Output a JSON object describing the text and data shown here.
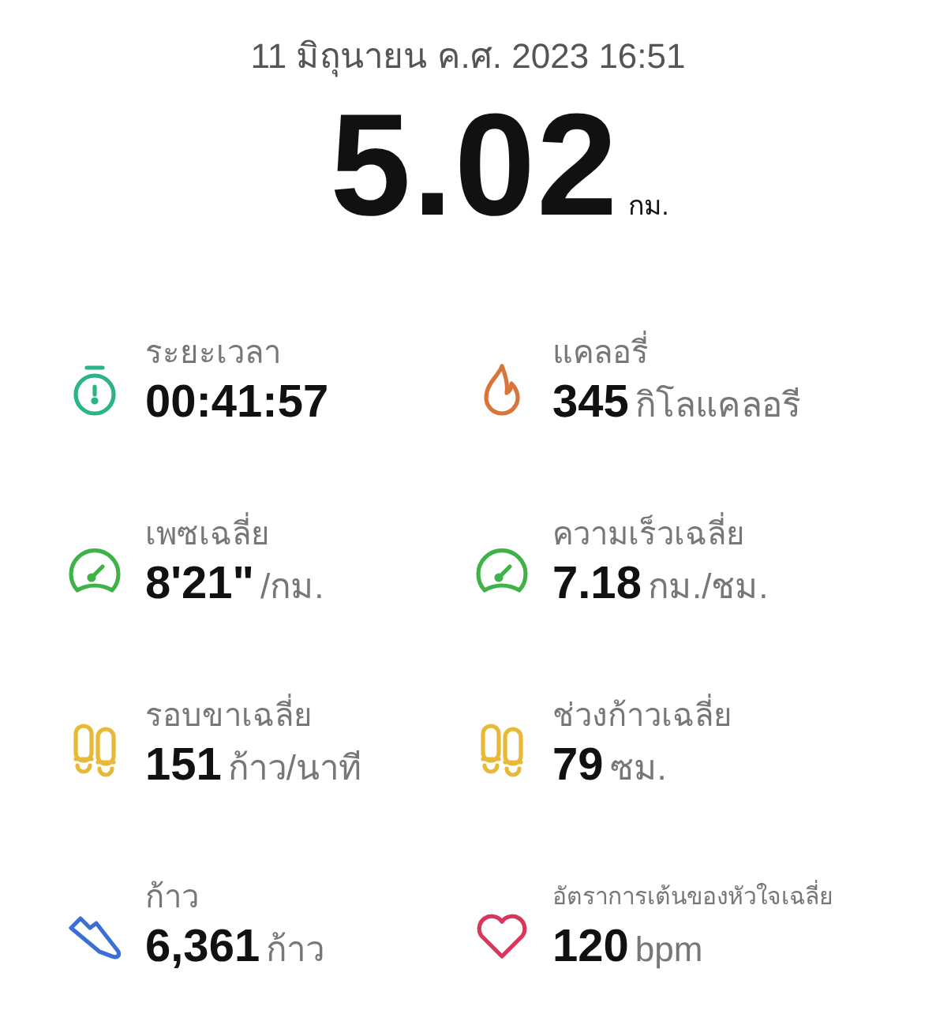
{
  "date": "11 มิถุนายน ค.ศ. 2023 16:51",
  "distance": {
    "value": "5.02",
    "unit": "กม."
  },
  "stats": [
    {
      "kind": "stopwatch",
      "color": "#2bb38a",
      "label": "ระยะเวลา",
      "value": "00:41:57"
    },
    {
      "kind": "flame",
      "color": "#d9743a",
      "label": "แคลอรี่",
      "value": "345",
      "unit": "กิโลแคลอรี"
    },
    {
      "kind": "gauge",
      "color": "#3fb24a",
      "label": "เพซเฉลี่ย",
      "value": "8'21\"",
      "unit": "/กม."
    },
    {
      "kind": "gauge",
      "color": "#3fb24a",
      "label": "ความเร็วเฉลี่ย",
      "value": "7.18",
      "unit": "กม./ชม."
    },
    {
      "kind": "footprints",
      "color": "#e8b936",
      "label": "รอบขาเฉลี่ย",
      "value": "151",
      "unit": "ก้าว/นาที"
    },
    {
      "kind": "footprints",
      "color": "#e8b936",
      "label": "ช่วงก้าวเฉลี่ย",
      "value": "79",
      "unit": "ซม."
    },
    {
      "kind": "shoe",
      "color": "#3b6fd6",
      "label": "ก้าว",
      "value": "6,361",
      "unit": "ก้าว"
    },
    {
      "kind": "heart",
      "color": "#d8365a",
      "label": "อัตราการเต้นของหัวใจเฉลี่ย",
      "value": "120",
      "unit": "bpm"
    }
  ]
}
